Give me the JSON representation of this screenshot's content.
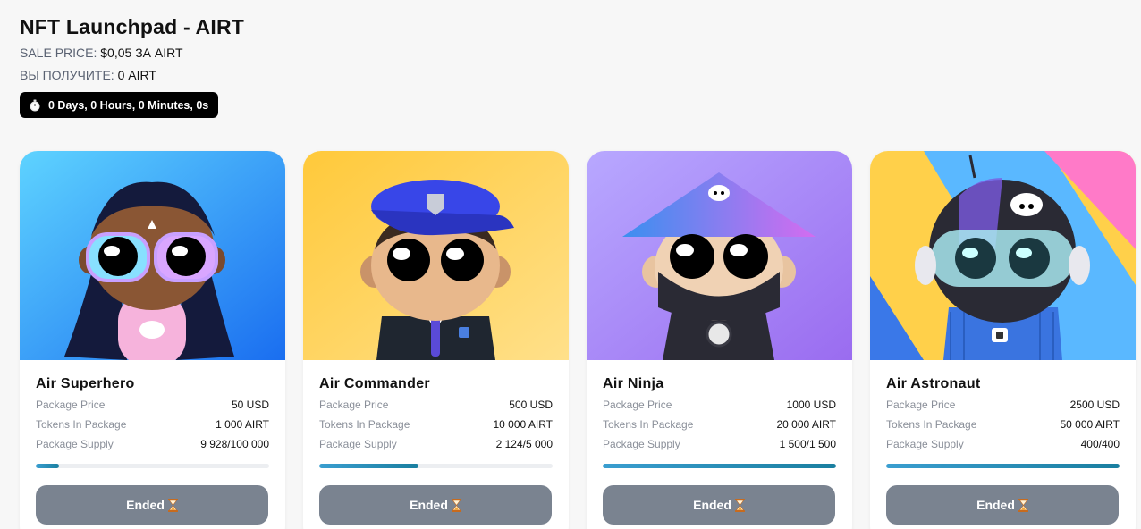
{
  "page": {
    "title": "NFT Launchpad - AIRT",
    "sale_price_label": "SALE PRICE:",
    "sale_price_value": "$0,05 ЗА AIRT",
    "receive_label": "ВЫ ПОЛУЧИТЕ:",
    "receive_value": "0 AIRT",
    "timer_text": "0 Days, 0 Hours, 0 Minutes, 0s"
  },
  "labels": {
    "package_price": "Package Price",
    "tokens_in_package": "Tokens In Package",
    "package_supply": "Package Supply"
  },
  "cards": [
    {
      "title": "Air Superhero",
      "price": "50 USD",
      "tokens": "1 000 AIRT",
      "supply": "9 928/100 000",
      "progress": 0.0993,
      "button": "Ended"
    },
    {
      "title": "Air Commander",
      "price": "500 USD",
      "tokens": "10 000 AIRT",
      "supply": "2 124/5 000",
      "progress": 0.4248,
      "button": "Ended"
    },
    {
      "title": "Air Ninja",
      "price": "1000 USD",
      "tokens": "20 000 AIRT",
      "supply": "1 500/1 500",
      "progress": 1.0,
      "button": "Ended"
    },
    {
      "title": "Air Astronaut",
      "price": "2500 USD",
      "tokens": "50 000 AIRT",
      "supply": "400/400",
      "progress": 1.0,
      "button": "Ended"
    }
  ],
  "colors": {
    "button_bg": "#7a8390",
    "progress_fill": "#2a8fbf",
    "timer_bg": "#000000",
    "card_bg": "#ffffff"
  }
}
